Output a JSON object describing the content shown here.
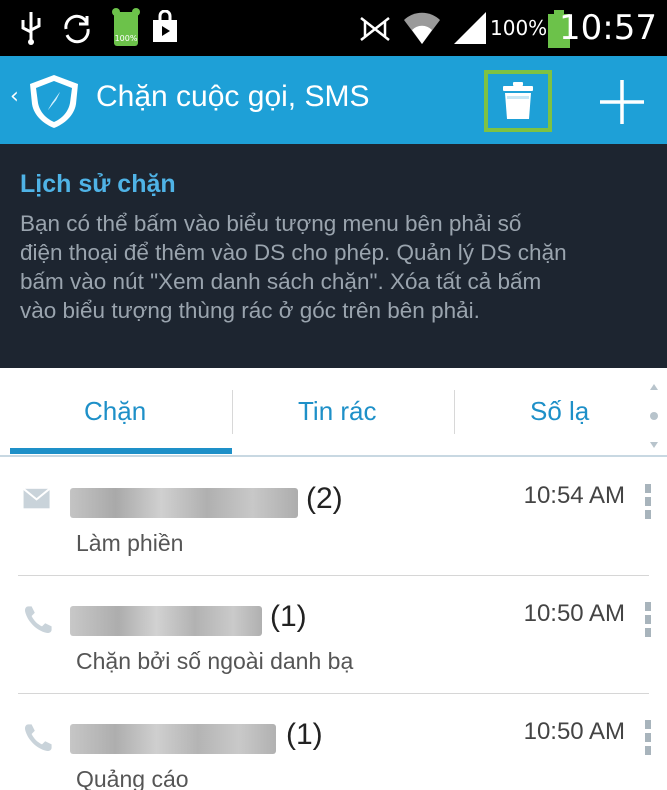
{
  "status_bar": {
    "battery_small_label": "100%",
    "battery_percent": "100%",
    "time": "10:57"
  },
  "action_bar": {
    "back_glyph": "‹",
    "title": "Chặn cuộc gọi, SMS",
    "icons": [
      "shield-logo-icon",
      "trash-icon",
      "plus-icon"
    ]
  },
  "info": {
    "title": "Lịch sử chặn",
    "lines": [
      "Bạn có thể bấm vào biểu tượng menu bên phải số",
      "điện thoại để thêm vào DS cho phép. Quản lý DS chặn",
      "bấm vào nút \"Xem danh sách chặn\". Xóa tất cả bấm",
      "vào biểu tượng thùng rác ở góc trên bên phải."
    ]
  },
  "tabs": [
    {
      "label": "Chặn",
      "selected": true
    },
    {
      "label": "Tin rác",
      "selected": false
    },
    {
      "label": "Số lạ",
      "selected": false
    }
  ],
  "items": [
    {
      "type": "sms",
      "count": "(2)",
      "time": "10:54 AM",
      "reason": "Làm phiền"
    },
    {
      "type": "call",
      "count": "(1)",
      "time": "10:50 AM",
      "reason": "Chặn bởi số ngoài danh bạ"
    },
    {
      "type": "call",
      "count": "(1)",
      "time": "10:50 AM",
      "reason": "Quảng cáo"
    }
  ],
  "colors": {
    "action_bar": "#1ea0d7",
    "info_bg": "#1d2530",
    "accent": "#1e90c8",
    "highlight": "#7ec242"
  }
}
